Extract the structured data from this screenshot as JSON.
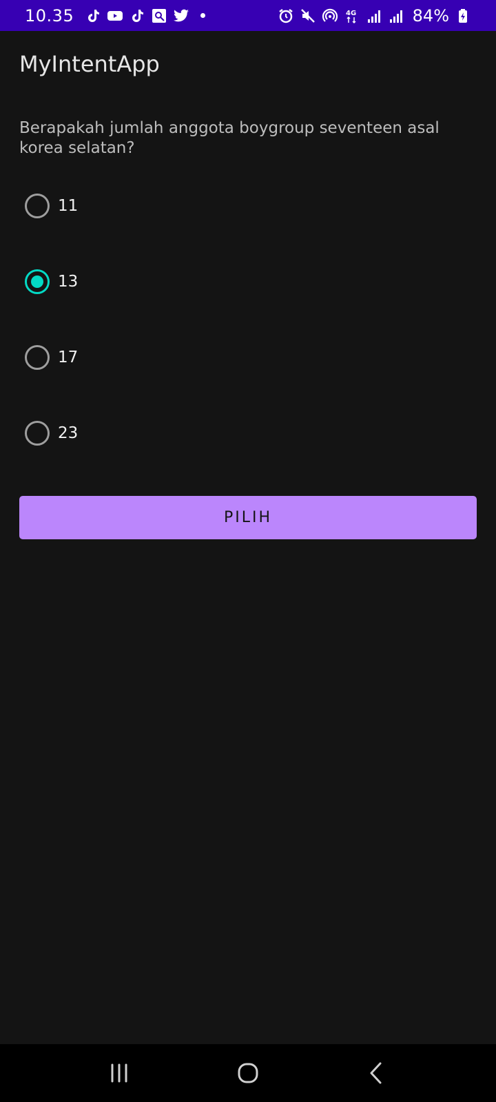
{
  "status_bar": {
    "time": "10.35",
    "left_icons": [
      "tiktok-icon",
      "youtube-icon",
      "tiktok-icon",
      "gallery-icon",
      "twitter-icon",
      "dot-icon"
    ],
    "right_icons": [
      "alarm-icon",
      "mute-icon",
      "hotspot-icon",
      "4g-icon",
      "signal-icon",
      "signal-icon",
      "battery-icon"
    ],
    "battery": "84%",
    "background": "#3700b3"
  },
  "app": {
    "title": "MyIntentApp"
  },
  "main": {
    "question": "Berapakah jumlah anggota boygroup seventeen asal korea selatan?",
    "options": [
      {
        "label": "11",
        "checked": false
      },
      {
        "label": "13",
        "checked": true
      },
      {
        "label": "17",
        "checked": false
      },
      {
        "label": "23",
        "checked": false
      }
    ],
    "button_label": "PILIH",
    "accent_color": "#03dac5",
    "button_color": "#bb86fc"
  },
  "nav_bar": {
    "buttons": [
      "recents-icon",
      "home-icon",
      "back-icon"
    ]
  }
}
